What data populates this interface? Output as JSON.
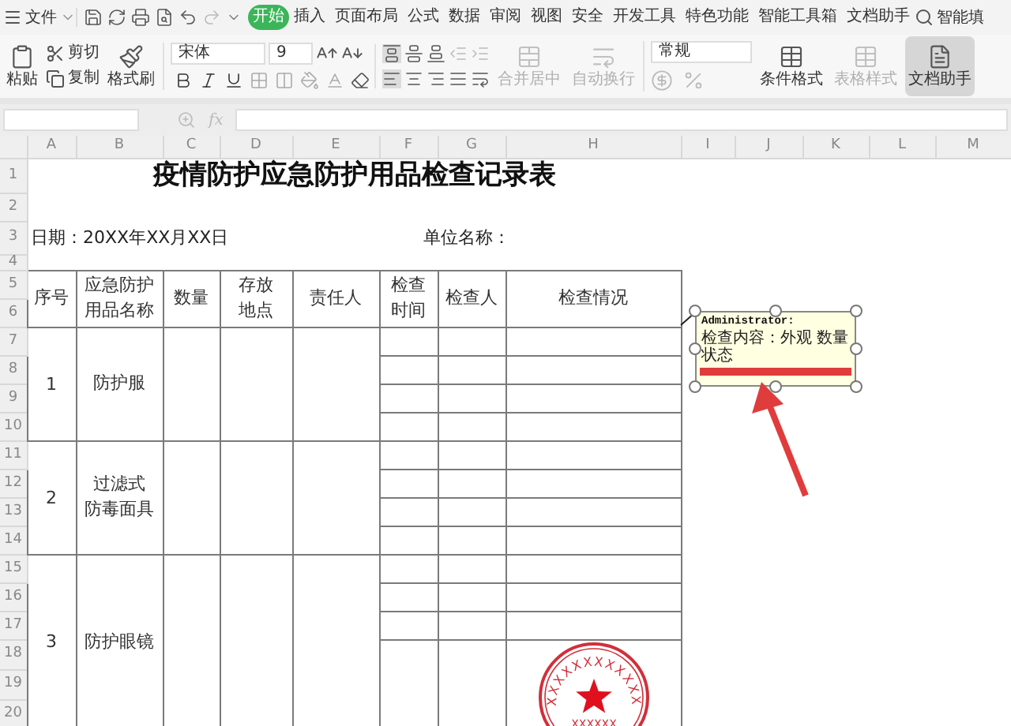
{
  "menu": {
    "file_label": "文件"
  },
  "tabs": [
    {
      "label": "开始",
      "selected": true
    },
    {
      "label": "插入",
      "selected": false
    },
    {
      "label": "页面布局",
      "selected": false
    },
    {
      "label": "公式",
      "selected": false
    },
    {
      "label": "数据",
      "selected": false
    },
    {
      "label": "审阅",
      "selected": false
    },
    {
      "label": "视图",
      "selected": false
    },
    {
      "label": "安全",
      "selected": false
    },
    {
      "label": "开发工具",
      "selected": false
    },
    {
      "label": "特色功能",
      "selected": false
    },
    {
      "label": "智能工具箱",
      "selected": false
    },
    {
      "label": "文档助手",
      "selected": false
    }
  ],
  "search": {
    "label": "智能填"
  },
  "ribbon": {
    "paste": "粘贴",
    "cut": "剪切",
    "copy": "复制",
    "format_painter": "格式刷",
    "font_name": "宋体",
    "font_size": "9",
    "merge": {
      "label": "合并居中",
      "disabled": true
    },
    "wrap": {
      "label": "自动换行",
      "disabled": true
    },
    "number_format": "常规",
    "conditional_format": {
      "label": "条件格式",
      "disabled": false
    },
    "table_style": {
      "label": "表格样式",
      "disabled": true
    },
    "doc_assistant": {
      "label": "文档助手",
      "selected": true
    }
  },
  "sheet": {
    "columns": [
      "A",
      "B",
      "C",
      "D",
      "E",
      "F",
      "G",
      "H",
      "I",
      "J",
      "K",
      "L",
      "M"
    ],
    "rows": [
      "1",
      "2",
      "3",
      "4",
      "5",
      "6",
      "7",
      "8",
      "9",
      "10",
      "11",
      "12",
      "13",
      "14",
      "15",
      "16",
      "17",
      "18",
      "19",
      "20"
    ],
    "title": "疫情防护应急防护用品检查记录表",
    "date_label": "日期：20XX年XX月XX日",
    "unit_label": "单位名称：",
    "headers": [
      {
        "lines": [
          "序号"
        ]
      },
      {
        "lines": [
          "应急防护",
          "用品名称"
        ]
      },
      {
        "lines": [
          "数量"
        ]
      },
      {
        "lines": [
          "存放",
          "地点"
        ]
      },
      {
        "lines": [
          "责任人"
        ]
      },
      {
        "lines": [
          "检查",
          "时间"
        ]
      },
      {
        "lines": [
          "检查人"
        ]
      },
      {
        "lines": [
          "检查情况"
        ]
      }
    ],
    "groups": [
      {
        "no": "1",
        "name_lines": [
          "防护服"
        ]
      },
      {
        "no": "2",
        "name_lines": [
          "过滤式",
          "防毒面具"
        ]
      },
      {
        "no": "3",
        "name_lines": [
          "防护眼镜"
        ],
        "stamp": {
          "ring_text": "XXXXXXXXXXXX",
          "bottom_text": "XXXXXX"
        }
      }
    ]
  },
  "formula_bar": {
    "fx": "fx"
  },
  "comment": {
    "author": "Administrator:",
    "text": "检查内容：外观 数量状态"
  }
}
